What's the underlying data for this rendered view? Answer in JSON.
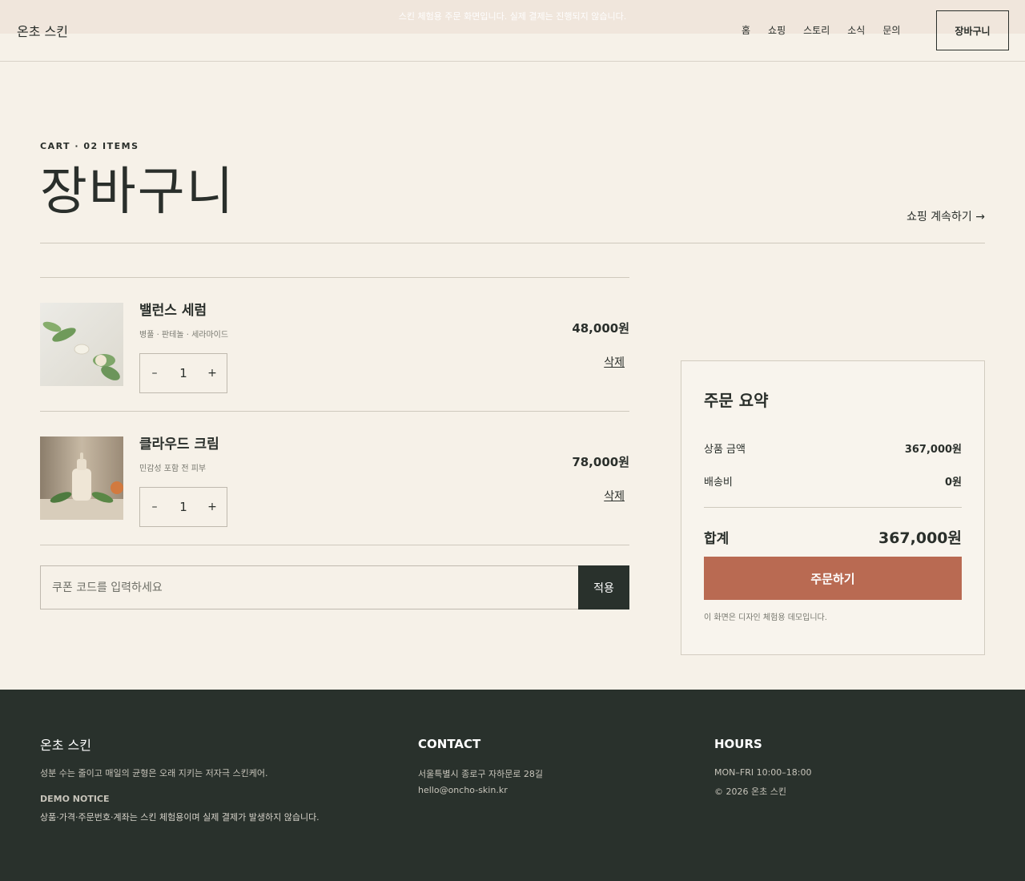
{
  "notice": "스킨 체험용 주문 화면입니다. 실제 결제는 진행되지 않습니다.",
  "header": {
    "brand": "온초 스킨",
    "nav": [
      "홈",
      "쇼핑",
      "스토리",
      "소식",
      "문의"
    ],
    "cart_button": "장바구니"
  },
  "hero": {
    "eyebrow": "CART · 02 ITEMS",
    "title": "장바구니",
    "continue_link": "쇼핑 계속하기 →"
  },
  "items": [
    {
      "name": "밸런스 세럼",
      "desc": "병풀 · 판테놀 · 세라마이드",
      "qty": "1",
      "price": "48,000원",
      "remove": "삭제",
      "image": "serum-with-leaves-photo"
    },
    {
      "name": "클라우드 크림",
      "desc": "민감성 포함 전 피부",
      "qty": "1",
      "price": "78,000원",
      "remove": "삭제",
      "image": "cream-bottle-photo"
    }
  ],
  "stepper": {
    "minus": "–",
    "plus": "+"
  },
  "coupon": {
    "placeholder": "쿠폰 코드를 입력하세요",
    "apply": "적용"
  },
  "summary": {
    "title": "주문 요약",
    "subtotal_label": "상품 금액",
    "subtotal_value": "367,000원",
    "shipping_label": "배송비",
    "shipping_value": "0원",
    "total_label": "합계",
    "total_value": "367,000원",
    "order_button": "주문하기",
    "note": "이 화면은 디자인 체험용 데모입니다."
  },
  "footer": {
    "brand": "온초 스킨",
    "tagline": "성분 수는 줄이고 매일의 균형은 오래 지키는 저자극 스킨케어.",
    "demo_heading": "DEMO NOTICE",
    "demo_text": "상품·가격·주문번호·계좌는 스킨 체험용이며 실제 결제가 발생하지 않습니다.",
    "contact_heading": "CONTACT",
    "address": "서울특별시 종로구 자하문로 28길",
    "email": "hello@oncho-skin.kr",
    "hours_heading": "HOURS",
    "hours": "MON–FRI 10:00–18:00",
    "copyright": "© 2026 온초 스킨"
  },
  "colors": {
    "background": "#f6f1e8",
    "accent": "#b96a52",
    "dark": "#29312c"
  }
}
